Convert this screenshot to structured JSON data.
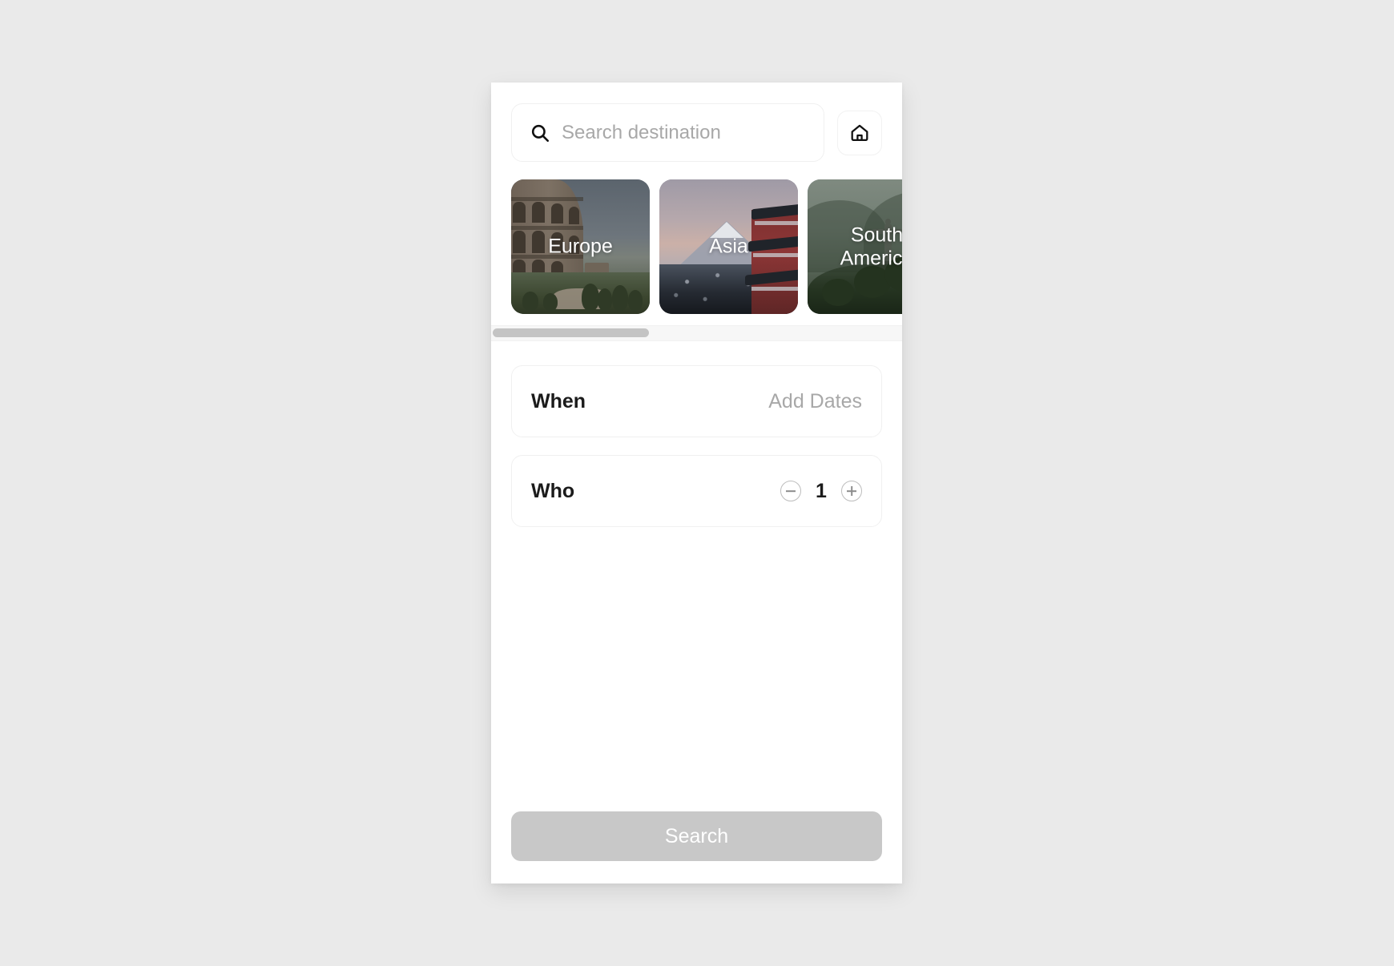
{
  "search": {
    "placeholder": "Search destination",
    "value": "",
    "icon": "search-icon"
  },
  "home_button": {
    "icon": "home-icon"
  },
  "destinations": [
    {
      "label": "Europe",
      "art": "colosseum"
    },
    {
      "label": "Asia",
      "art": "mount-fuji-pagoda"
    },
    {
      "label": "South\nAmerica",
      "art": "christ-the-redeemer"
    }
  ],
  "carousel_scrollbar": {
    "thumb_width_percent": 38,
    "thumb_position_percent": 0
  },
  "fields": {
    "when": {
      "label": "When",
      "value": "Add Dates"
    },
    "who": {
      "label": "Who",
      "count": "1",
      "decrement_icon": "minus-circle-icon",
      "increment_icon": "plus-circle-icon"
    }
  },
  "footer": {
    "search_label": "Search"
  },
  "colors": {
    "page_background": "#eaeaea",
    "app_background": "#ffffff",
    "text_primary": "#1b1b1b",
    "text_muted": "#a8a8a8",
    "border": "#f0f0f0",
    "button_disabled": "#c8c8c8",
    "scrollbar_thumb": "#c4c4c4"
  }
}
